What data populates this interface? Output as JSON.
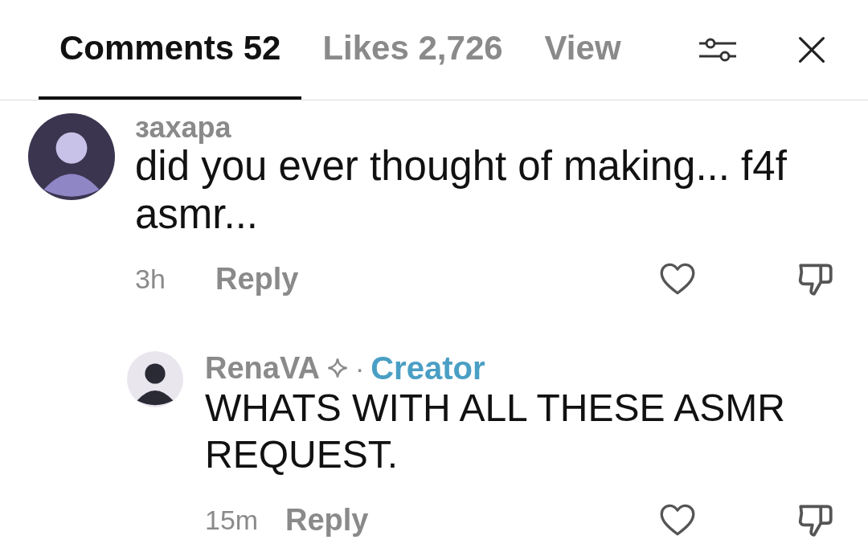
{
  "tabs": [
    {
      "label": "Comments 52",
      "selected": true
    },
    {
      "label": "Likes 2,726",
      "selected": false
    },
    {
      "label": "View",
      "selected": false
    }
  ],
  "comments": [
    {
      "username": "захара",
      "text": "did you ever thought of making... f4f asmr...",
      "time": "3h",
      "reply_label": "Reply",
      "liked": false,
      "children": [
        {
          "username": "RenaVA",
          "separator": "·",
          "badge": "Creator",
          "text": "WHATS WITH ALL THESE ASMR REQUEST.",
          "time": "15m",
          "reply_label": "Reply",
          "liked": false
        }
      ]
    }
  ]
}
